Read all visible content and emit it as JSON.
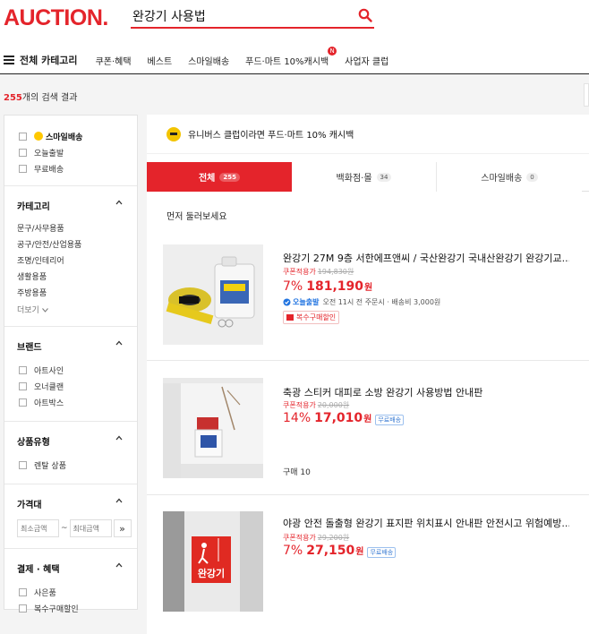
{
  "header": {
    "logo": "AUCTION.",
    "search_value": "완강기 사용법"
  },
  "gnb": {
    "all_category": "전체 카테고리",
    "items": [
      "쿠폰·혜택",
      "베스트",
      "스마일배송",
      "푸드·마트 10%캐시백",
      "사업자 클럽"
    ],
    "badge": "N"
  },
  "results": {
    "count": "255",
    "suffix": "개의 검색 결과"
  },
  "sidebar": {
    "delivery": {
      "smile": "스마일배송",
      "today": "오늘출발",
      "free": "무료배송"
    },
    "category": {
      "title": "카테고리",
      "items": [
        "문구/사무용품",
        "공구/안전/산업용품",
        "조명/인테리어",
        "생활용품",
        "주방용품"
      ],
      "more": "더보기"
    },
    "brand": {
      "title": "브랜드",
      "items": [
        "아트사인",
        "오너클랜",
        "아트박스"
      ]
    },
    "product_type": {
      "title": "상품유형",
      "items": [
        "렌탈 상품"
      ]
    },
    "price": {
      "title": "가격대",
      "min_placeholder": "최소금액",
      "max_placeholder": "최대금액",
      "tilde": "~",
      "go": "»"
    },
    "benefit": {
      "title": "결제 · 혜택",
      "items": [
        "사은품",
        "복수구매할인"
      ]
    }
  },
  "main": {
    "banner": "유니버스 클럽이라면 푸드·마트 10% 캐시백",
    "tabs": [
      {
        "label": "전체",
        "count": "255"
      },
      {
        "label": "백화점·몰",
        "count": "34"
      },
      {
        "label": "스마일배송",
        "count": "0"
      }
    ],
    "section_label": "먼저 둘러보세요",
    "products": [
      {
        "title": "완강기 27M 9층 서한에프앤씨 / 국산완강기 국내산완강기 완강기교...",
        "coupon_label": "쿠폰적용가",
        "original": "194,830원",
        "discount": "7%",
        "price": "181,190",
        "won": "원",
        "delivery_badge": "오늘출발",
        "delivery_text": "오전 11시 전 주문시 · 배송비 3,000원",
        "tag": "복수구매할인"
      },
      {
        "title": "축광 스티커 대피로 소방 완강기 사용방법 안내판",
        "coupon_label": "쿠폰적용가",
        "original": "20,000원",
        "discount": "14%",
        "price": "17,010",
        "won": "원",
        "free_tag": "무료배송",
        "buys": "구매 10"
      },
      {
        "title": "야광 안전 돌출형 완강기 표지판 위치표시 안내판 안전시고 위험예방...",
        "coupon_label": "쿠폰적용가",
        "original": "29,200원",
        "discount": "7%",
        "price": "27,150",
        "won": "원",
        "free_tag": "무료배송",
        "sign_text": "완강기"
      }
    ]
  },
  "colors": {
    "accent": "#e4242b",
    "blue": "#1f73e0",
    "smile": "#ffc800"
  }
}
